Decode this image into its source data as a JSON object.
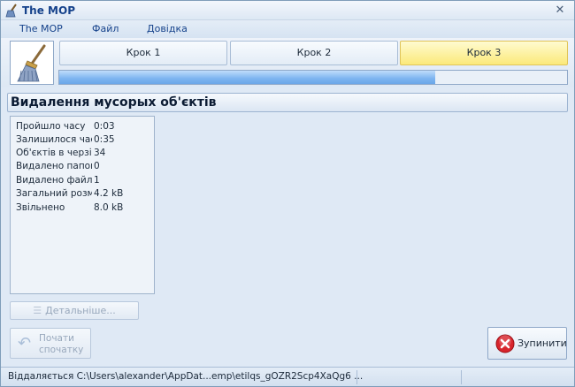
{
  "window": {
    "title": "The MOP",
    "icon": "mop-app-icon",
    "close_icon": "close-icon"
  },
  "menu": [
    "The MOP",
    "Файл",
    "Довідка"
  ],
  "steps": [
    {
      "label": "Крок 1",
      "active": false
    },
    {
      "label": "Крок 2",
      "active": false
    },
    {
      "label": "Крок 3",
      "active": true
    }
  ],
  "progress": {
    "fraction": 0.74
  },
  "section": {
    "title": "Видалення мусорых об'єктів"
  },
  "stats": [
    {
      "label": "Пройшло часу",
      "value": "0:03"
    },
    {
      "label": "Залишилося часу",
      "value": "0:35"
    },
    {
      "label": "Об'єктів в черзі",
      "value": "34"
    },
    {
      "label": "Видалено папок",
      "value": "0"
    },
    {
      "label": "Видалено файлів",
      "value": "1"
    },
    {
      "label": "Загальний розмір",
      "value": "4.2 kB"
    },
    {
      "label": "Звільнено",
      "value": "8.0 kB"
    }
  ],
  "buttons": {
    "details": "Детальніше...",
    "restart_line1": "Почати",
    "restart_line2": "спочатку",
    "stop": "Зупинити"
  },
  "status": {
    "text": "Віддаляється C:\\Users\\alexander\\AppDat...emp\\etilqs_gOZR2Scp4XaQg6 ..."
  },
  "colors": {
    "accent": "#15428b",
    "active_step": "#fbe97a",
    "progress": "#7cb4f0",
    "stop_icon": "#d8252c"
  }
}
